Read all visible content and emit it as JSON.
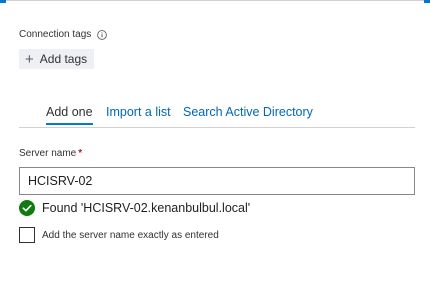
{
  "tags": {
    "label": "Connection tags",
    "info_icon": "info-icon",
    "add_label": "Add tags"
  },
  "tabs": [
    {
      "label": "Add one",
      "active": true
    },
    {
      "label": "Import a list",
      "active": false
    },
    {
      "label": "Search Active Directory",
      "active": false
    }
  ],
  "server": {
    "label": "Server name",
    "required_mark": "*",
    "value": "HCISRV-02"
  },
  "status": {
    "icon": "check-circle-icon",
    "text": "Found 'HCISRV-02.kenanbulbul.local'",
    "color": "#107c10"
  },
  "exact_match": {
    "label": "Add the server name exactly as entered",
    "checked": false
  },
  "colors": {
    "accent": "#0078d4",
    "link": "#0067b8",
    "required": "#a4262c"
  }
}
